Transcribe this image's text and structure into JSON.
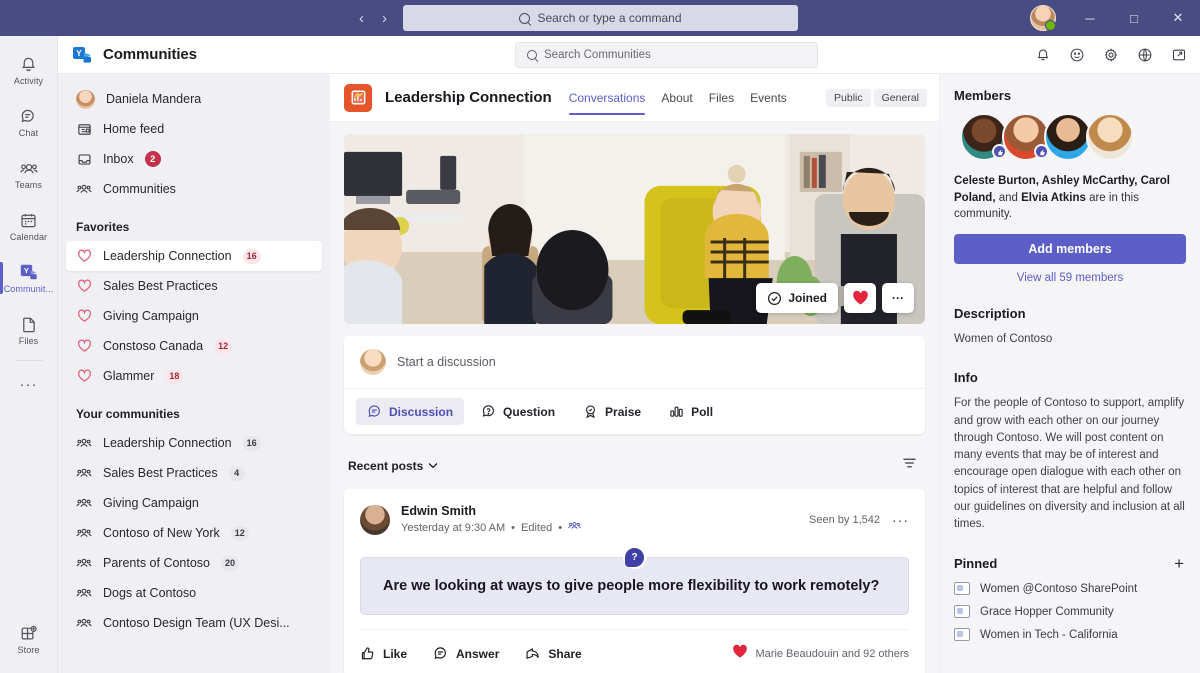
{
  "titlebar": {
    "back_icon": "‹",
    "forward_icon": "›",
    "search_placeholder": "Search or type a command",
    "minimize_label": "─",
    "maximize_label": "□",
    "close_label": "✕"
  },
  "rail": {
    "items": [
      {
        "label": "Activity",
        "icon": "bell-icon"
      },
      {
        "label": "Chat",
        "icon": "chat-icon"
      },
      {
        "label": "Teams",
        "icon": "teams-icon"
      },
      {
        "label": "Calendar",
        "icon": "calendar-icon"
      },
      {
        "label": "Communit...",
        "icon": "communities-icon"
      },
      {
        "label": "Files",
        "icon": "files-icon"
      }
    ],
    "more_label": "···",
    "store_label": "Store"
  },
  "app_header": {
    "title": "Communities",
    "search_placeholder": "Search Communities",
    "icons": [
      "bell-icon",
      "smiley-icon",
      "gear-icon",
      "globe-icon",
      "popout-icon"
    ]
  },
  "left_nav": {
    "user": "Daniela Mandera",
    "primary": [
      {
        "label": "Home feed",
        "icon": "home-feed-icon",
        "badge": ""
      },
      {
        "label": "Inbox",
        "icon": "inbox-icon",
        "badge": "2"
      },
      {
        "label": "Communities",
        "icon": "communities-group-icon",
        "badge": ""
      }
    ],
    "favorites_title": "Favorites",
    "favorites": [
      {
        "label": "Leadership Connection",
        "badge": "16",
        "selected": true
      },
      {
        "label": "Sales Best Practices",
        "badge": ""
      },
      {
        "label": "Giving Campaign",
        "badge": ""
      },
      {
        "label": "Constoso Canada",
        "badge": "12"
      },
      {
        "label": "Glammer",
        "badge": "18"
      }
    ],
    "communities_title": "Your communities",
    "communities": [
      {
        "label": "Leadership Connection",
        "badge": "16"
      },
      {
        "label": "Sales Best Practices",
        "badge": "4"
      },
      {
        "label": "Giving Campaign",
        "badge": ""
      },
      {
        "label": "Contoso of New York",
        "badge": "12"
      },
      {
        "label": "Parents of Contoso",
        "badge": "20"
      },
      {
        "label": "Dogs at Contoso",
        "badge": ""
      },
      {
        "label": "Contoso Design Team (UX Desi...",
        "badge": ""
      }
    ]
  },
  "community": {
    "name": "Leadership Connection",
    "tabs": [
      {
        "label": "Conversations",
        "active": true
      },
      {
        "label": "About",
        "active": false
      },
      {
        "label": "Files",
        "active": false
      },
      {
        "label": "Events",
        "active": false
      }
    ],
    "chips": [
      "Public",
      "General"
    ],
    "hero_buttons": {
      "joined_label": "Joined",
      "favorite_icon": "heart-icon",
      "more_label": "···"
    }
  },
  "composer": {
    "placeholder": "Start a discussion",
    "types": [
      {
        "label": "Discussion",
        "active": true
      },
      {
        "label": "Question",
        "active": false
      },
      {
        "label": "Praise",
        "active": false
      },
      {
        "label": "Poll",
        "active": false
      }
    ]
  },
  "feed": {
    "sort_label": "Recent posts",
    "sort_caret": "⌄",
    "posts": [
      {
        "author": "Edwin Smith",
        "meta_time": "Yesterday at 9:30 AM",
        "meta_edited": "Edited",
        "meta_sep": "•",
        "seen_by": "Seen by 1,542",
        "more_label": "···",
        "question_badge": "?",
        "body": "Are we looking at ways to give people more flexibility to work remotely?",
        "actions": [
          "Like",
          "Answer",
          "Share"
        ],
        "reactions_text": "Marie Beaudouin and 92 others"
      }
    ]
  },
  "right_panel": {
    "members_title": "Members",
    "members_text_names": "Celeste Burton, Ashley McCarthy, Carol Poland,",
    "members_text_and": " and ",
    "members_text_last": "Elvia Atkins",
    "members_text_tail": " are in this community.",
    "add_members_label": "Add members",
    "view_all_label": "View all 59 members",
    "description_title": "Description",
    "description_body": "Women of Contoso",
    "info_title": "Info",
    "info_body": "For the people of Contoso to support, amplify and grow with each other on our journey through Contoso. We will post content on many events that may be of interest and encourage open dialogue with each other on topics of interest that are helpful and follow our guidelines on diversity and inclusion at all times.",
    "pinned_title": "Pinned",
    "pinned_add": "+",
    "pinned": [
      "Women @Contoso SharePoint",
      "Grace Hopper Community",
      "Women in Tech - California"
    ]
  },
  "colors": {
    "titlebar": "#494b83",
    "accent": "#5b5fc7",
    "badge_red": "#c4314b",
    "heart_red": "#e0253c",
    "community_avatar": "#e4562a"
  }
}
